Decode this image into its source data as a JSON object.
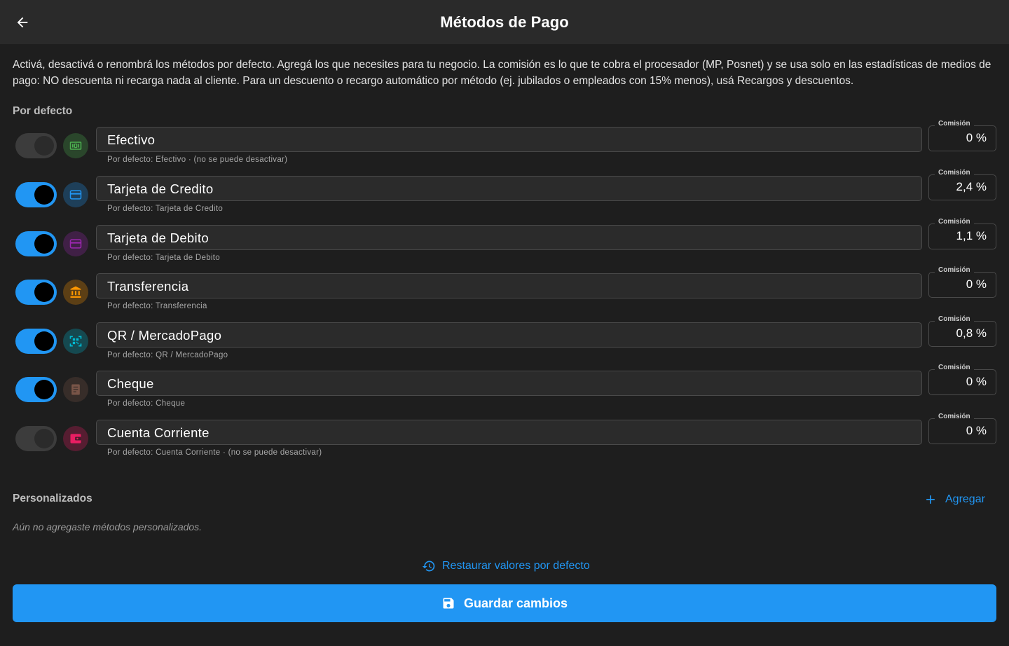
{
  "appbar": {
    "title": "Métodos de Pago",
    "back_icon": "arrow-back-icon"
  },
  "intro": "Activá, desactivá o renombrá los métodos por defecto. Agregá los que necesites para tu negocio. La comisión es lo que te cobra el procesador (MP, Posnet) y se usa solo en las estadísticas de medios de pago: NO descuenta ni recarga nada al cliente. Para un descuento o recargo automático por método (ej. jubilados o empleados con 15% menos), usá Recargos y descuentos.",
  "defaults_label": "Por defecto",
  "commission_label": "Comisión",
  "methods": [
    {
      "name": "Efectivo",
      "helper": "Por defecto: Efectivo  ·  (no se puede desactivar)",
      "commission": "0 %",
      "enabled": true,
      "locked": true,
      "icon": "cash-icon",
      "color": "#4caf50"
    },
    {
      "name": "Tarjeta de Credito",
      "helper": "Por defecto: Tarjeta de Credito",
      "commission": "2,4 %",
      "enabled": true,
      "locked": false,
      "icon": "credit-card-icon",
      "color": "#2196f3"
    },
    {
      "name": "Tarjeta de Debito",
      "helper": "Por defecto: Tarjeta de Debito",
      "commission": "1,1 %",
      "enabled": true,
      "locked": false,
      "icon": "debit-card-icon",
      "color": "#9c27b0"
    },
    {
      "name": "Transferencia",
      "helper": "Por defecto: Transferencia",
      "commission": "0 %",
      "enabled": true,
      "locked": false,
      "icon": "bank-icon",
      "color": "#ff9800"
    },
    {
      "name": "QR / MercadoPago",
      "helper": "Por defecto: QR / MercadoPago",
      "commission": "0,8 %",
      "enabled": true,
      "locked": false,
      "icon": "qr-scan-icon",
      "color": "#00bcd4"
    },
    {
      "name": "Cheque",
      "helper": "Por defecto: Cheque",
      "commission": "0 %",
      "enabled": true,
      "locked": false,
      "icon": "cheque-icon",
      "color": "#795548"
    },
    {
      "name": "Cuenta Corriente",
      "helper": "Por defecto: Cuenta Corriente  ·  (no se puede desactivar)",
      "commission": "0 %",
      "enabled": true,
      "locked": true,
      "icon": "wallet-icon",
      "color": "#e91e63"
    }
  ],
  "custom": {
    "label": "Personalizados",
    "add_label": "Agregar",
    "empty_text": "Aún no agregaste métodos personalizados."
  },
  "restore_label": "Restaurar valores por defecto",
  "save_label": "Guardar cambios"
}
